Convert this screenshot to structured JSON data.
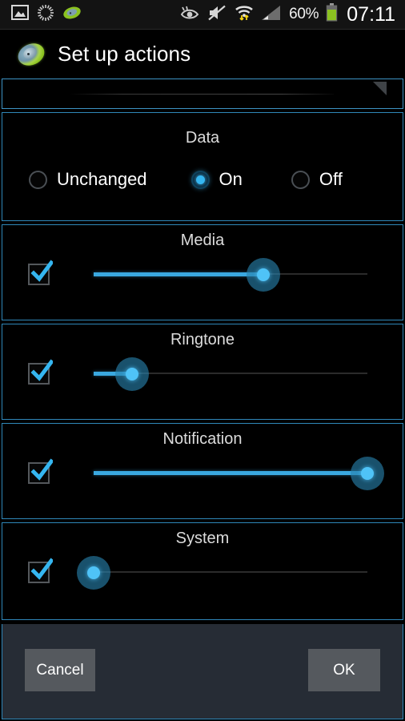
{
  "statusbar": {
    "left_icons": [
      {
        "name": "image-icon",
        "glyph": "picture"
      },
      {
        "name": "sync-spinner-icon",
        "glyph": "spinner"
      },
      {
        "name": "app-notification-icon",
        "glyph": "green-disc"
      }
    ],
    "right_icons": [
      {
        "name": "smart-stay-eye-icon",
        "glyph": "eye"
      },
      {
        "name": "sound-muted-icon",
        "glyph": "speaker-mute"
      },
      {
        "name": "wifi-transfer-icon",
        "glyph": "wifi-arrows"
      },
      {
        "name": "cellular-signal-icon",
        "glyph": "signal-bars"
      }
    ],
    "battery_percent": "60%",
    "battery_icon": "battery-icon",
    "clock": "07:11"
  },
  "titlebar": {
    "icon": "app-logo-icon",
    "title": "Set up actions"
  },
  "colors": {
    "accent": "#3aa8e0",
    "accent_bright": "#4fc3f7",
    "section_border": "#2f87b8",
    "background": "#000000",
    "bottombar": "#262c35",
    "button": "#55595e"
  },
  "sections": [
    {
      "type": "textfield",
      "name": "scrolled-text-field-row",
      "value": "",
      "placeholder": "",
      "handle": "resize-handle-icon"
    },
    {
      "type": "radio",
      "name": "data-section",
      "title": "Data",
      "options": [
        {
          "label": "Unchanged",
          "selected": false
        },
        {
          "label": "On",
          "selected": true
        },
        {
          "label": "Off",
          "selected": false
        }
      ]
    },
    {
      "type": "slider",
      "name": "media-section",
      "title": "Media",
      "checked": true,
      "value_percent": 62
    },
    {
      "type": "slider",
      "name": "ringtone-section",
      "title": "Ringtone",
      "checked": true,
      "value_percent": 14
    },
    {
      "type": "slider",
      "name": "notification-section",
      "title": "Notification",
      "checked": true,
      "value_percent": 100
    },
    {
      "type": "slider",
      "name": "system-section",
      "title": "System",
      "checked": true,
      "value_percent": 0
    }
  ],
  "bottombar": {
    "cancel_label": "Cancel",
    "ok_label": "OK"
  }
}
